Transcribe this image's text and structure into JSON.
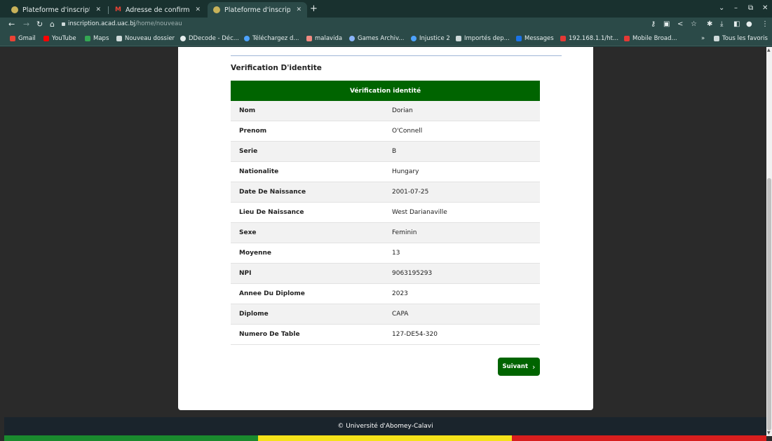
{
  "browser": {
    "tabs": [
      {
        "title": "Plateforme d'inscription",
        "icon": "uac-favicon"
      },
      {
        "title": "Adresse de confirmation",
        "icon": "gmail-icon"
      },
      {
        "title": "Plateforme d'inscription",
        "icon": "uac-favicon",
        "active": true
      }
    ],
    "new_tab": "+",
    "url": {
      "host": "inscription.acad.uac.bj",
      "path": "/home/nouveau"
    },
    "bookmarks": [
      {
        "label": "Gmail",
        "color": "#ea4335"
      },
      {
        "label": "YouTube",
        "color": "#ff0000"
      },
      {
        "label": "Maps",
        "color": "#34a853"
      },
      {
        "label": "Nouveau dossier",
        "color": "#cfdada"
      },
      {
        "label": "DDecode - Déc...",
        "color": "#e6eeee"
      },
      {
        "label": "Téléchargez d...",
        "color": "#4da3ff"
      },
      {
        "label": "malavida",
        "color": "#f28b82"
      },
      {
        "label": "Games Archiv...",
        "color": "#8ab4f8"
      },
      {
        "label": "Injustice 2",
        "color": "#4da3ff"
      },
      {
        "label": "Importés dep...",
        "color": "#cfdada"
      },
      {
        "label": "Messages",
        "color": "#1a73e8"
      },
      {
        "label": "192.168.1.1/ht...",
        "color": "#e53935"
      },
      {
        "label": "Mobile Broad...",
        "color": "#e53935"
      }
    ],
    "bookmarks_overflow": "»",
    "all_bookmarks": "Tous les favoris"
  },
  "page": {
    "section_title": "Verification D'identite",
    "table_header": "Vérification identité",
    "rows": [
      {
        "label": "Nom",
        "value": "Dorian"
      },
      {
        "label": "Prenom",
        "value": "O'Connell"
      },
      {
        "label": "Serie",
        "value": "B"
      },
      {
        "label": "Nationalite",
        "value": "Hungary"
      },
      {
        "label": "Date De Naissance",
        "value": "2001-07-25"
      },
      {
        "label": "Lieu De Naissance",
        "value": "West Darianaville"
      },
      {
        "label": "Sexe",
        "value": "Feminin"
      },
      {
        "label": "Moyenne",
        "value": "13"
      },
      {
        "label": "NPI",
        "value": "9063195293"
      },
      {
        "label": "Annee Du Diplome",
        "value": "2023"
      },
      {
        "label": "Diplome",
        "value": "CAPA"
      },
      {
        "label": "Numero De Table",
        "value": "127-DE54-320"
      }
    ],
    "next_button": "Suivant",
    "footer": "© Université d'Abomey-Calavi"
  },
  "colors": {
    "primary_green": "#006400",
    "footer": "#1a242c",
    "flag_green": "#1a8a2e",
    "flag_yellow": "#f5e21a",
    "flag_red": "#d81e1e"
  }
}
